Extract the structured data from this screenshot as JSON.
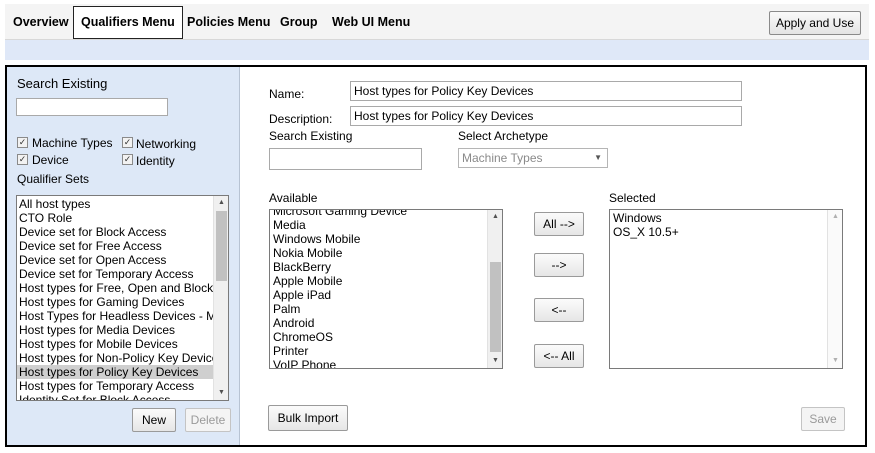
{
  "nav": {
    "tabs": [
      "Overview",
      "Qualifiers Menu",
      "Policies Menu",
      "Group",
      "Web UI Menu"
    ],
    "apply_label": "Apply and Use"
  },
  "left": {
    "search_label": "Search Existing",
    "search_value": "",
    "checkboxes": [
      {
        "label": "Machine Types",
        "checked": true
      },
      {
        "label": "Networking",
        "checked": true
      },
      {
        "label": "Device",
        "checked": true
      },
      {
        "label": "Identity",
        "checked": true
      }
    ],
    "sets_label": "Qualifier Sets",
    "items": [
      "All host types",
      "CTO Role",
      "Device set for Block Access",
      "Device set for Free Access",
      "Device set for Open Access",
      "Device set for Temporary Access",
      "Host types for Free, Open and Block",
      "Host types for Gaming Devices",
      "Host Types for Headless Devices - M",
      "Host types for Media Devices",
      "Host types for Mobile Devices",
      "Host types for Non-Policy Key Device",
      "Host types for Policy Key Devices",
      "Host types for Temporary Access",
      "Identity Set for Block Access"
    ],
    "selected_item": "Host types for Policy Key Devices",
    "new_label": "New",
    "delete_label": "Delete"
  },
  "form": {
    "name_label": "Name:",
    "name_value": "Host types for Policy Key Devices",
    "description_label": "Description:",
    "description_value": "Host types for Policy Key Devices",
    "search_label": "Search Existing",
    "search_value": "",
    "archetype_label": "Select Archetype",
    "archetype_value": "Machine Types",
    "available_label": "Available",
    "available_items": [
      "Microsoft Gaming Device",
      "Media",
      "Windows Mobile",
      "Nokia Mobile",
      "BlackBerry",
      "Apple Mobile",
      "Apple iPad",
      "Palm",
      "Android",
      "ChromeOS",
      "Printer",
      "VoIP Phone"
    ],
    "selected_label": "Selected",
    "selected_items": [
      "Windows",
      "OS_X 10.5+"
    ],
    "btn_all_right": "All -->",
    "btn_right": "-->",
    "btn_left": "<--",
    "btn_all_left": "<-- All",
    "bulk_import_label": "Bulk Import",
    "save_label": "Save"
  }
}
